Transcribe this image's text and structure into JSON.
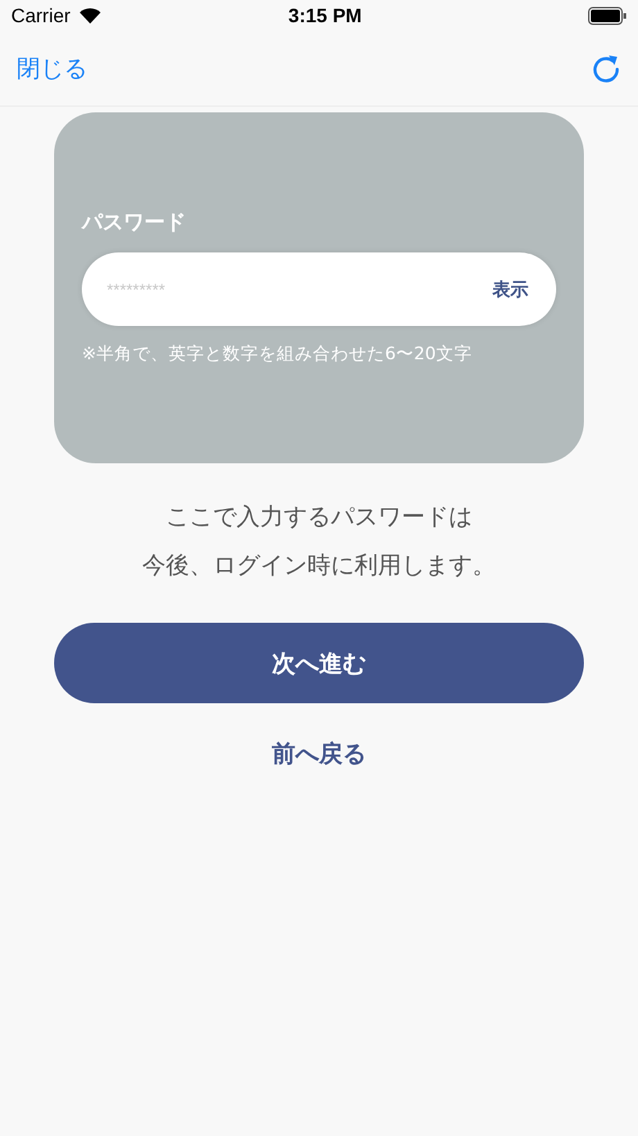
{
  "status_bar": {
    "carrier": "Carrier",
    "time": "3:15 PM"
  },
  "nav": {
    "close": "閉じる"
  },
  "card": {
    "label": "パスワード",
    "field": {
      "placeholder": "*********",
      "toggle": "表示"
    },
    "hint": "※半角で、英字と数字を組み合わせた6〜20文字"
  },
  "description": [
    "ここで入力するパスワードは",
    "今後、ログイン時に利用します。"
  ],
  "primary_button": "次へ進む",
  "back_link": "前へ戻る"
}
